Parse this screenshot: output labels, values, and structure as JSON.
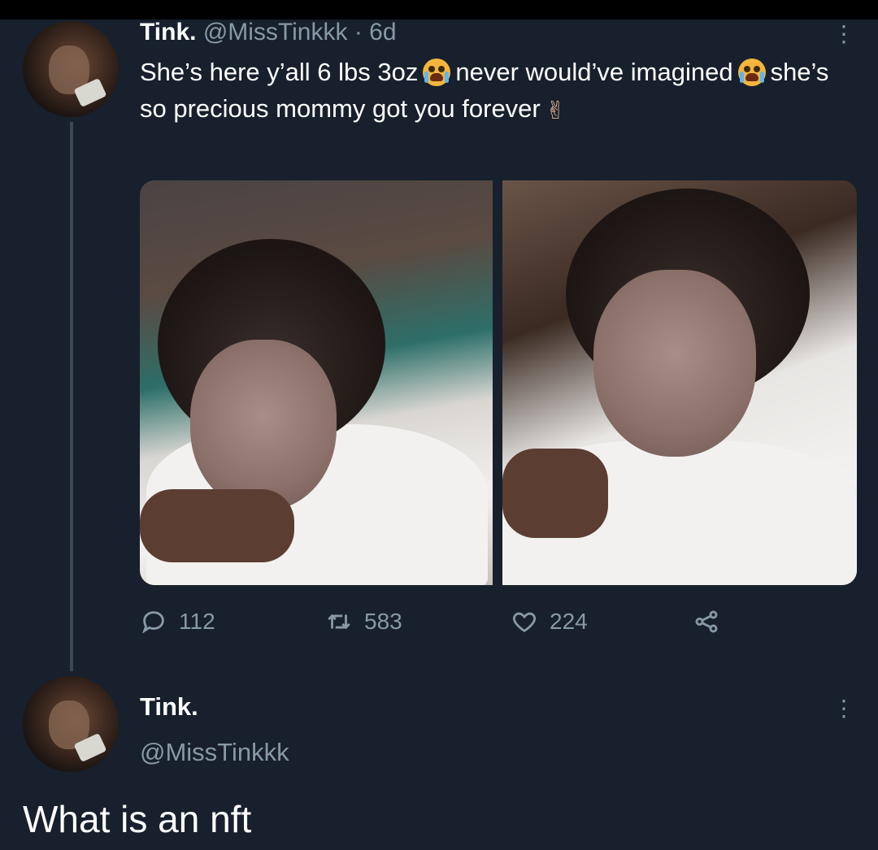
{
  "tweet": {
    "author_name": "Tink.",
    "author_handle": "@MissTinkkk",
    "separator": "·",
    "time": "6d",
    "text_part1": "She’s here y’all 6 lbs  3oz",
    "text_part2": "never would’ve imagined",
    "text_part3": "she’s so precious mommy got you forever",
    "emoji_1": "crying-face-emoji",
    "emoji_2": "crying-face-emoji",
    "emoji_3": "fingers-crossed-emoji",
    "stats": {
      "replies": "112",
      "retweets": "583",
      "likes": "224"
    }
  },
  "reply": {
    "author_name": "Tink.",
    "author_handle": "@MissTinkkk",
    "text": "What is an nft"
  },
  "colors": {
    "background": "#17202c",
    "secondary_text": "#8899a6",
    "primary_text": "#ffffff"
  }
}
